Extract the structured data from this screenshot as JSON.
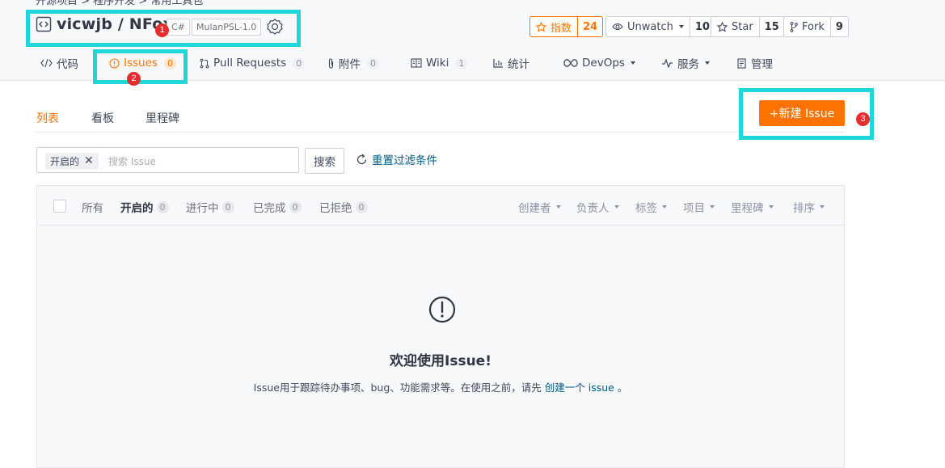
{
  "breadcrumb_partial": "开源项目 > 程序开发 > 常用工具包",
  "repo": {
    "owner_name": "vicwjb / NFox",
    "language_tag": "C#",
    "license_tag": "MulanPSL-1.0"
  },
  "stats": {
    "index": {
      "label": "指数",
      "count": "24"
    },
    "watch": {
      "label": "Unwatch",
      "count": "10"
    },
    "star": {
      "label": "Star",
      "count": "15"
    },
    "fork": {
      "label": "Fork",
      "count": "9"
    }
  },
  "tabs": [
    {
      "label": "代码"
    },
    {
      "label": "Issues",
      "count": "0"
    },
    {
      "label": "Pull Requests",
      "count": "0"
    },
    {
      "label": "附件",
      "count": "0"
    },
    {
      "label": "Wiki",
      "count": "1"
    },
    {
      "label": "统计"
    },
    {
      "label": "DevOps"
    },
    {
      "label": "服务"
    },
    {
      "label": "管理"
    }
  ],
  "subnav": [
    "列表",
    "看板",
    "里程碑"
  ],
  "new_issue_label": "+新建 Issue",
  "filter": {
    "chip_label": "开启的",
    "placeholder": "搜索 Issue",
    "search_label": "搜索",
    "reset_label": "重置过滤条件"
  },
  "states": [
    {
      "label": "所有"
    },
    {
      "label": "开启的",
      "count": "0"
    },
    {
      "label": "进行中",
      "count": "0"
    },
    {
      "label": "已完成",
      "count": "0"
    },
    {
      "label": "已拒绝",
      "count": "0"
    }
  ],
  "sorters": [
    "创建者",
    "负责人",
    "标签",
    "项目",
    "里程碑",
    "排序"
  ],
  "empty": {
    "title": "欢迎使用Issue!",
    "desc_before": "Issue用于跟踪待办事项、bug、功能需求等。在使用之前，请先",
    "link": "创建一个 issue",
    "desc_after": "。"
  },
  "annotations": [
    "1",
    "2",
    "3"
  ],
  "colors": {
    "accent": "#fe7300",
    "highlight": "#1fd6d8",
    "annotation_badge": "#e52d2d",
    "link": "#005980"
  }
}
